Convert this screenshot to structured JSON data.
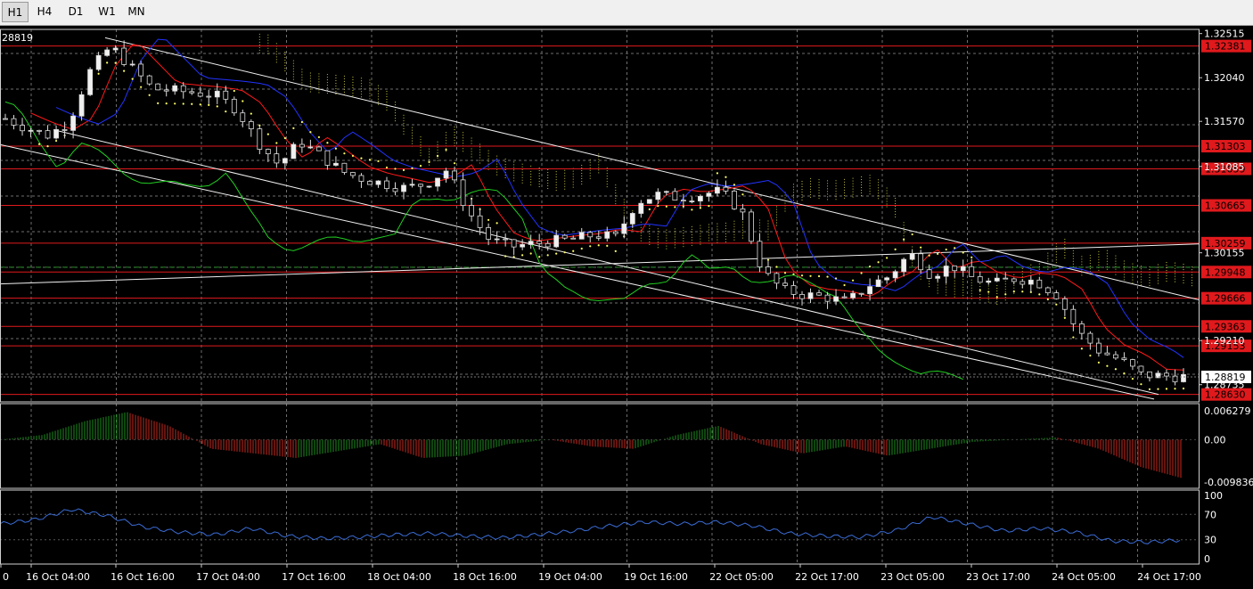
{
  "toolbar": {
    "timeframes": [
      "H1",
      "H4",
      "D1",
      "W1",
      "MN"
    ],
    "selected": "H1"
  },
  "price_pane": {
    "current_price_label": "1.28819",
    "corner_label": "28819",
    "scale_ticks": [
      "1.32515",
      "1.32040",
      "1.31570",
      "1.31085",
      "1.30155",
      "1.29210",
      "1.28735"
    ],
    "red_levels": [
      "1.32381",
      "1.31303",
      "1.31059",
      "1.30665",
      "1.30259",
      "1.29948",
      "1.29666",
      "1.29363",
      "1.29153",
      "1.28630"
    ]
  },
  "macd_pane": {
    "scale_ticks": [
      "0.006279",
      "0.00",
      "-0.009836"
    ]
  },
  "osc_pane": {
    "scale_ticks": [
      "100",
      "70",
      "30",
      "0"
    ]
  },
  "time_axis": {
    "labels": [
      "0",
      "16 Oct 04:00",
      "16 Oct 16:00",
      "17 Oct 04:00",
      "17 Oct 16:00",
      "18 Oct 04:00",
      "18 Oct 16:00",
      "19 Oct 04:00",
      "19 Oct 16:00",
      "22 Oct 05:00",
      "22 Oct 17:00",
      "23 Oct 05:00",
      "23 Oct 17:00",
      "24 Oct 05:00",
      "24 Oct 17:00"
    ]
  },
  "colors": {
    "background": "#000000",
    "grid": "#6e6e6e",
    "level_line": "#e0191c",
    "level_box": "#e0191c",
    "candle_bull": "#f0f0f0",
    "candle_bear": "#000000",
    "tenkan": "#ff1a1a",
    "kijun": "#2233ff",
    "chikou": "#22cc22",
    "cloud": "#e8e84a",
    "channel": "#f0f0f0",
    "macd_up": "#1e8c1e",
    "macd_down": "#c8281e",
    "osc_line": "#3a6cd6",
    "axis_text": "#ffffff"
  },
  "chart_data": {
    "type": "candlestick",
    "symbol_period": "H1",
    "y_range": [
      1.2855,
      1.3256
    ],
    "close_path": [
      1.316,
      1.315,
      1.3142,
      1.3155,
      1.321,
      1.3238,
      1.3215,
      1.3192,
      1.319,
      1.3188,
      1.3185,
      1.317,
      1.3135,
      1.311,
      1.3135,
      1.312,
      1.3103,
      1.3095,
      1.309,
      1.3085,
      1.309,
      1.3105,
      1.306,
      1.303,
      1.3022,
      1.3025,
      1.3028,
      1.303,
      1.3035,
      1.3032,
      1.307,
      1.3078,
      1.3075,
      1.3078,
      1.3082,
      1.306,
      1.2995,
      1.2975,
      1.297,
      1.2968,
      1.2962,
      1.298,
      1.299,
      1.3015,
      1.2992,
      1.3002,
      1.2988,
      1.2982,
      1.2988,
      1.2985,
      1.297,
      1.293,
      1.291,
      1.29,
      1.2884,
      1.2883,
      1.2882
    ],
    "macd_range": [
      -0.009836,
      0.006279
    ],
    "macd_profile": [
      0.0,
      0.001,
      0.004,
      0.006,
      0.003,
      -0.002,
      -0.003,
      -0.004,
      -0.0025,
      -0.001,
      -0.004,
      -0.0035,
      -0.001,
      0.0,
      -0.0015,
      -0.002,
      0.001,
      0.003,
      -0.001,
      -0.003,
      -0.0015,
      -0.0035,
      -0.002,
      -0.0005,
      0.0,
      0.0005,
      -0.002,
      -0.006,
      -0.0085
    ],
    "osc_range": [
      0,
      100
    ],
    "osc_profile": [
      55,
      62,
      78,
      68,
      50,
      42,
      38,
      48,
      36,
      32,
      34,
      38,
      40,
      36,
      33,
      38,
      44,
      52,
      58,
      55,
      58,
      52,
      40,
      36,
      34,
      45,
      66,
      55,
      44,
      48,
      42,
      28,
      26,
      30
    ]
  }
}
